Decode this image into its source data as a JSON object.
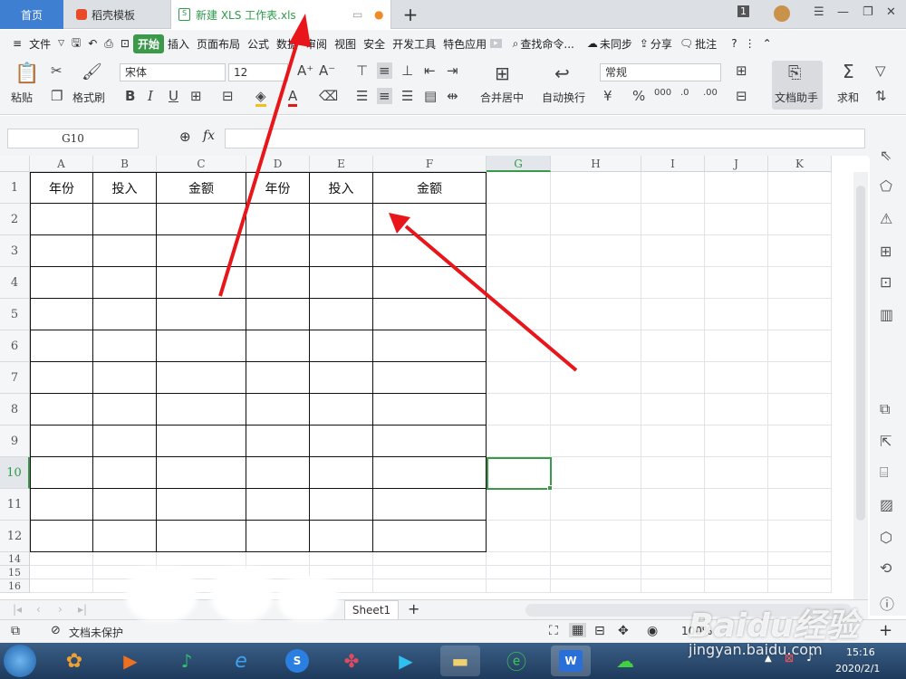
{
  "tabs": {
    "home": "首页",
    "template": "稻壳模板",
    "file": "新建 XLS 工作表.xls",
    "new_tab": "+"
  },
  "window": {
    "badge": "1"
  },
  "menu": {
    "file": "文件",
    "items": [
      "开始",
      "插入",
      "页面布局",
      "公式",
      "数据",
      "审阅",
      "视图",
      "安全",
      "开发工具",
      "特色应用"
    ],
    "search": "查找命令...",
    "sync": "未同步",
    "share": "分享",
    "comment": "批注",
    "help": "?"
  },
  "ribbon": {
    "paste": "粘贴",
    "format_painter": "格式刷",
    "font": "宋体",
    "size": "12",
    "merge": "合并居中",
    "wrap": "自动换行",
    "numfmt": "常规",
    "assistant": "文档助手",
    "sum": "求和"
  },
  "formula": {
    "namebox": "G10",
    "fx": "fx",
    "value": ""
  },
  "sheet": {
    "columns": [
      "A",
      "B",
      "C",
      "D",
      "E",
      "F",
      "G",
      "H",
      "I",
      "J",
      "K"
    ],
    "rows": [
      "1",
      "2",
      "3",
      "4",
      "5",
      "6",
      "7",
      "8",
      "9",
      "10",
      "11",
      "12",
      "14",
      "15",
      "16"
    ],
    "headers": [
      "年份",
      "投入",
      "金额",
      "年份",
      "投入",
      "金额"
    ],
    "active_cell": "G10"
  },
  "sheet_tabs": {
    "sheet1": "Sheet1",
    "add": "+"
  },
  "status": {
    "protect": "文档未保护",
    "zoom": "100%"
  },
  "taskbar": {
    "time": "15:16",
    "date": "2020/2/1"
  },
  "watermark": {
    "brand": "Baidu经验",
    "url": "jingyan.baidu.com"
  },
  "colors": {
    "accent_green": "#3a9a4a",
    "home_tab": "#3f7fd1",
    "arrow": "#e8161a"
  }
}
